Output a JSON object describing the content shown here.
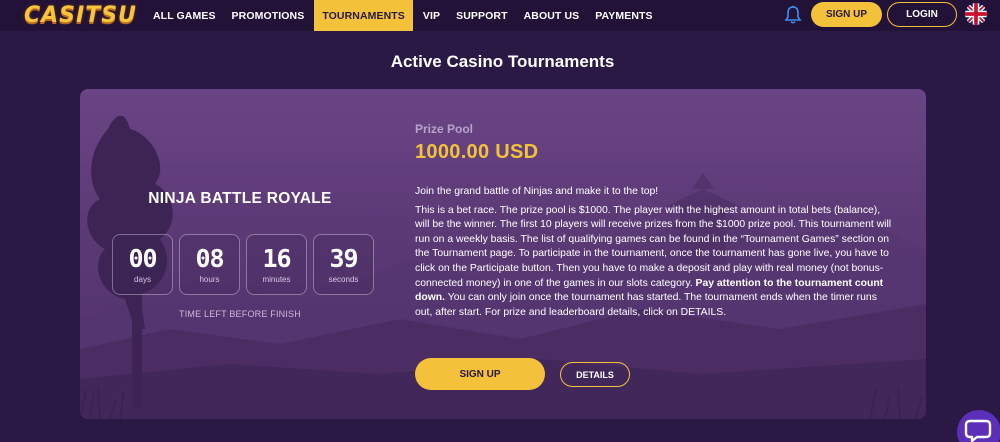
{
  "header": {
    "logo_text": "CASITSU",
    "nav": [
      {
        "label": "ALL GAMES",
        "active": false
      },
      {
        "label": "PROMOTIONS",
        "active": false
      },
      {
        "label": "TOURNAMENTS",
        "active": true
      },
      {
        "label": "VIP",
        "active": false
      },
      {
        "label": "SUPPORT",
        "active": false
      },
      {
        "label": "ABOUT US",
        "active": false
      },
      {
        "label": "PAYMENTS",
        "active": false
      }
    ],
    "bell_icon": "bell-icon",
    "signup_label": "SIGN UP",
    "login_label": "LOGIN",
    "language_icon": "uk-flag-icon"
  },
  "page": {
    "title": "Active Casino Tournaments"
  },
  "tournament": {
    "name": "NINJA BATTLE ROYALE",
    "countdown": [
      {
        "value": "00",
        "unit": "days"
      },
      {
        "value": "08",
        "unit": "hours"
      },
      {
        "value": "16",
        "unit": "minutes"
      },
      {
        "value": "39",
        "unit": "seconds"
      }
    ],
    "time_left_label": "TIME LEFT BEFORE FINISH",
    "prize_label": "Prize Pool",
    "prize_value": "1000.00 USD",
    "intro": "Join the grand battle of Ninjas and make it to the top!",
    "description_part1": "This is a bet race. The prize pool is $1000. The player with the highest amount in total bets (balance), will be the winner. The first 10 players will receive prizes from the $1000 prize pool. This tournament will run on a weekly basis. The list of qualifying games can be found in the “Tournament Games” section on the Tournament page. To participate in the tournament, once the tournament has gone live, you have to click on the Participate button. Then you have to make a deposit and play with real money (not bonus-connected money) in one of the games in our slots category.",
    "description_bold": "Pay attention to the tournament count down.",
    "description_part2": "You can only join once the tournament has started. The tournament ends when the timer runs out, after start. For prize and leaderboard details, click on DETAILS.",
    "signup_label": "SIGN UP",
    "details_label": "DETAILS"
  },
  "colors": {
    "accent": "#f3c13a",
    "background": "#2a1845",
    "card": "#5c3a76"
  },
  "chat_icon": "chat-bubble-icon"
}
